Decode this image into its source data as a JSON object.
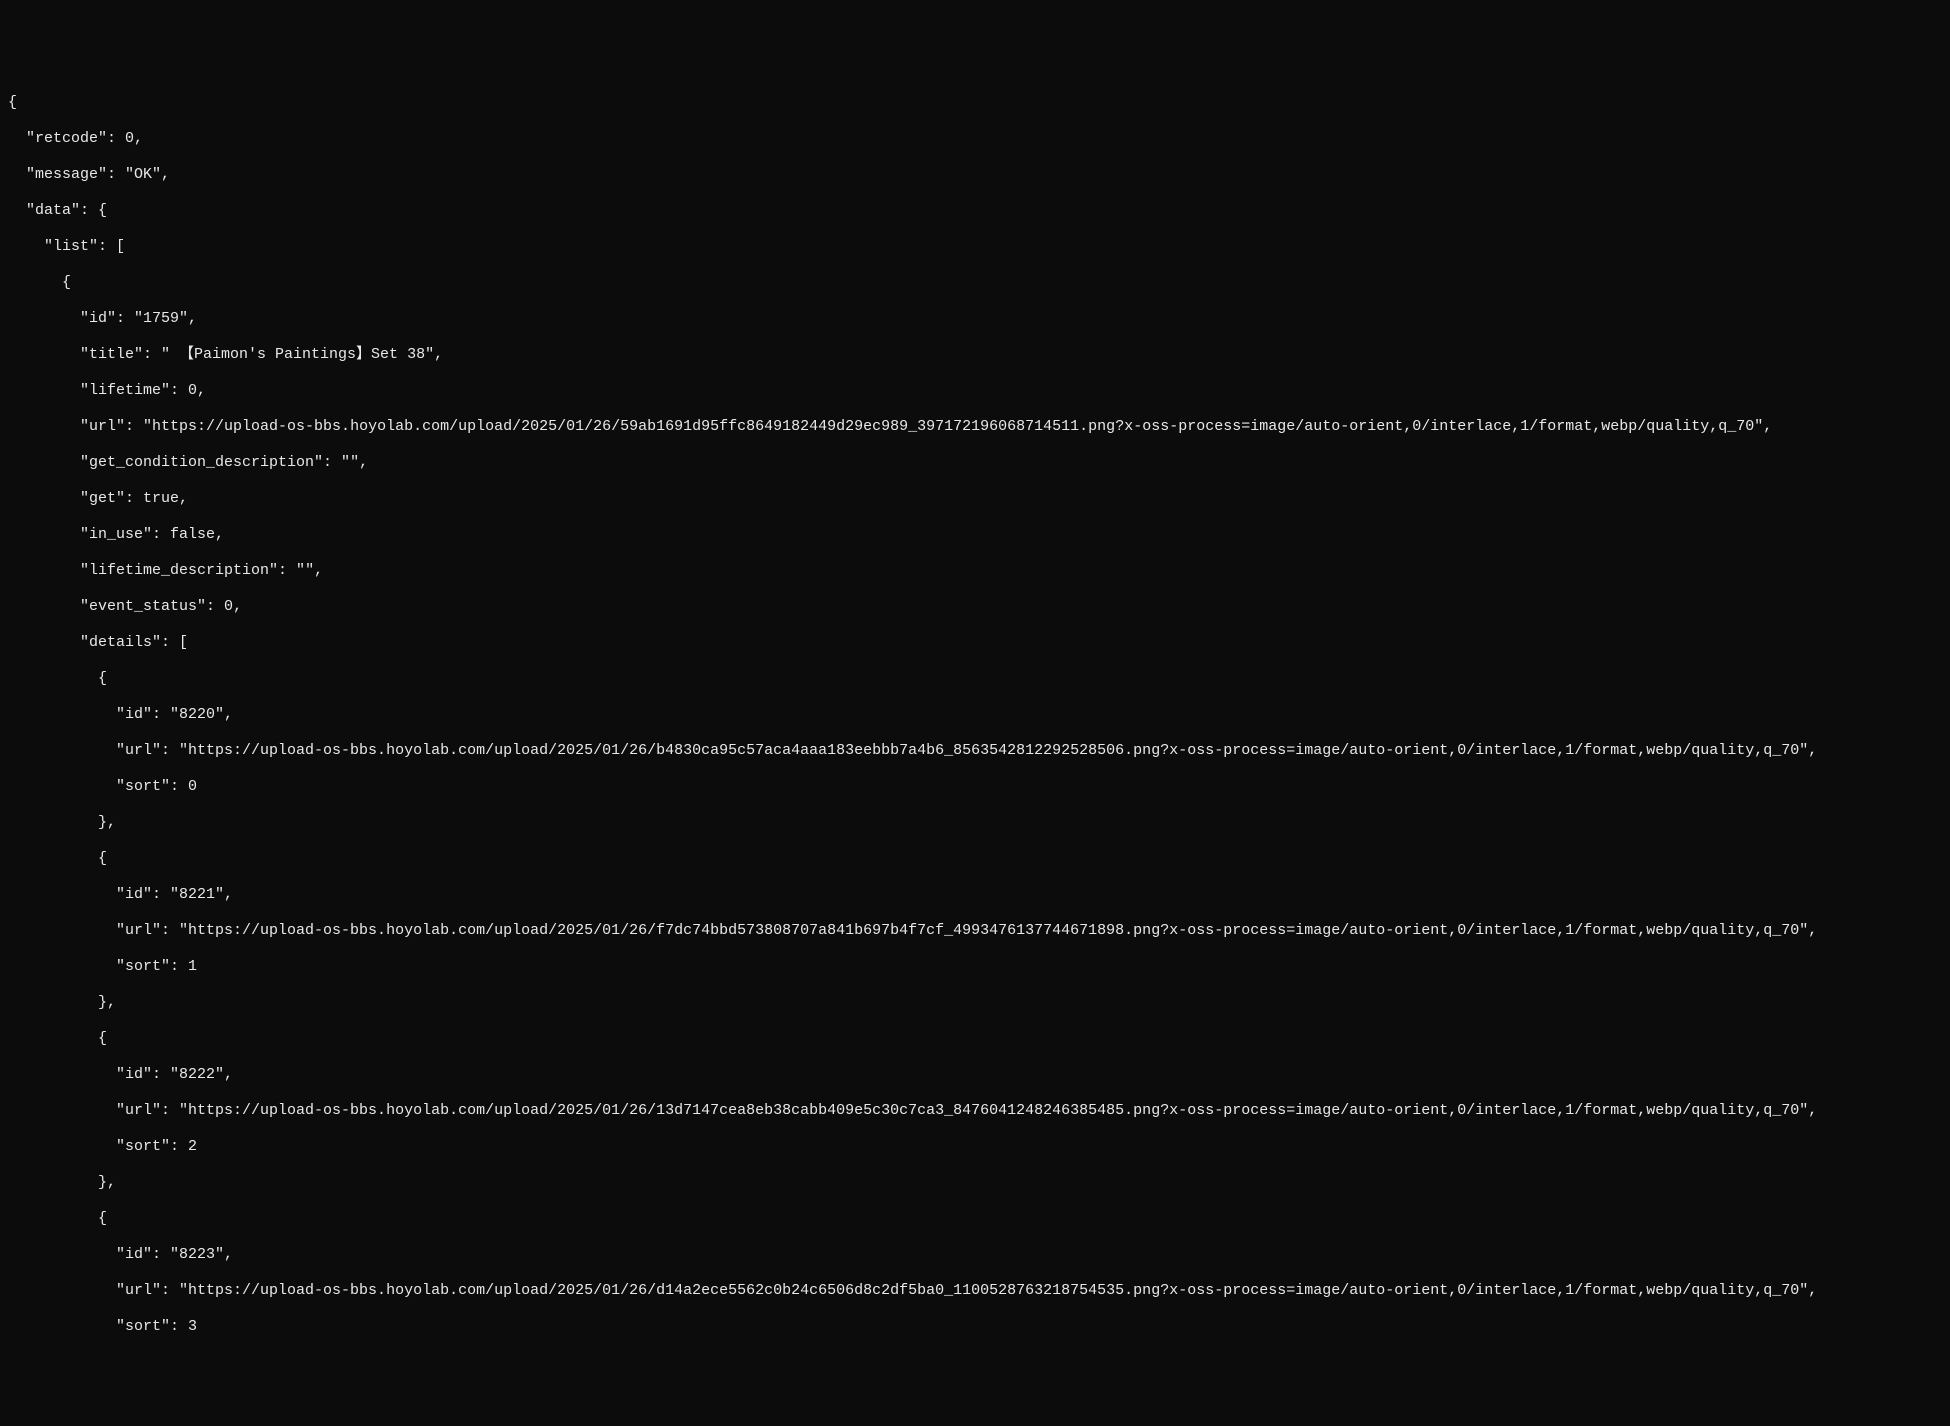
{
  "retcode": 0,
  "message": "OK",
  "data": {
    "list": [
      {
        "id": "1759",
        "title": " 【Paimon's Paintings】Set 38",
        "lifetime": 0,
        "url": "https://upload-os-bbs.hoyolab.com/upload/2025/01/26/59ab1691d95ffc8649182449d29ec989_397172196068714511.png?x-oss-process=image/auto-orient,0/interlace,1/format,webp/quality,q_70",
        "get_condition_description": "",
        "get": true,
        "in_use": false,
        "lifetime_description": "",
        "event_status": 0,
        "details": [
          {
            "id": "8220",
            "url": "https://upload-os-bbs.hoyolab.com/upload/2025/01/26/b4830ca95c57aca4aaa183eebbb7a4b6_8563542812292528506.png?x-oss-process=image/auto-orient,0/interlace,1/format,webp/quality,q_70",
            "sort": 0
          },
          {
            "id": "8221",
            "url": "https://upload-os-bbs.hoyolab.com/upload/2025/01/26/f7dc74bbd573808707a841b697b4f7cf_4993476137744671898.png?x-oss-process=image/auto-orient,0/interlace,1/format,webp/quality,q_70",
            "sort": 1
          },
          {
            "id": "8222",
            "url": "https://upload-os-bbs.hoyolab.com/upload/2025/01/26/13d7147cea8eb38cabb409e5c30c7ca3_8476041248246385485.png?x-oss-process=image/auto-orient,0/interlace,1/format,webp/quality,q_70",
            "sort": 2
          },
          {
            "id": "8223",
            "url": "https://upload-os-bbs.hoyolab.com/upload/2025/01/26/d14a2ece5562c0b24c6506d8c2df5ba0_1100528763218754535.png?x-oss-process=image/auto-orient,0/interlace,1/format,webp/quality,q_70",
            "sort": 3
          }
        ]
      }
    ]
  }
}
